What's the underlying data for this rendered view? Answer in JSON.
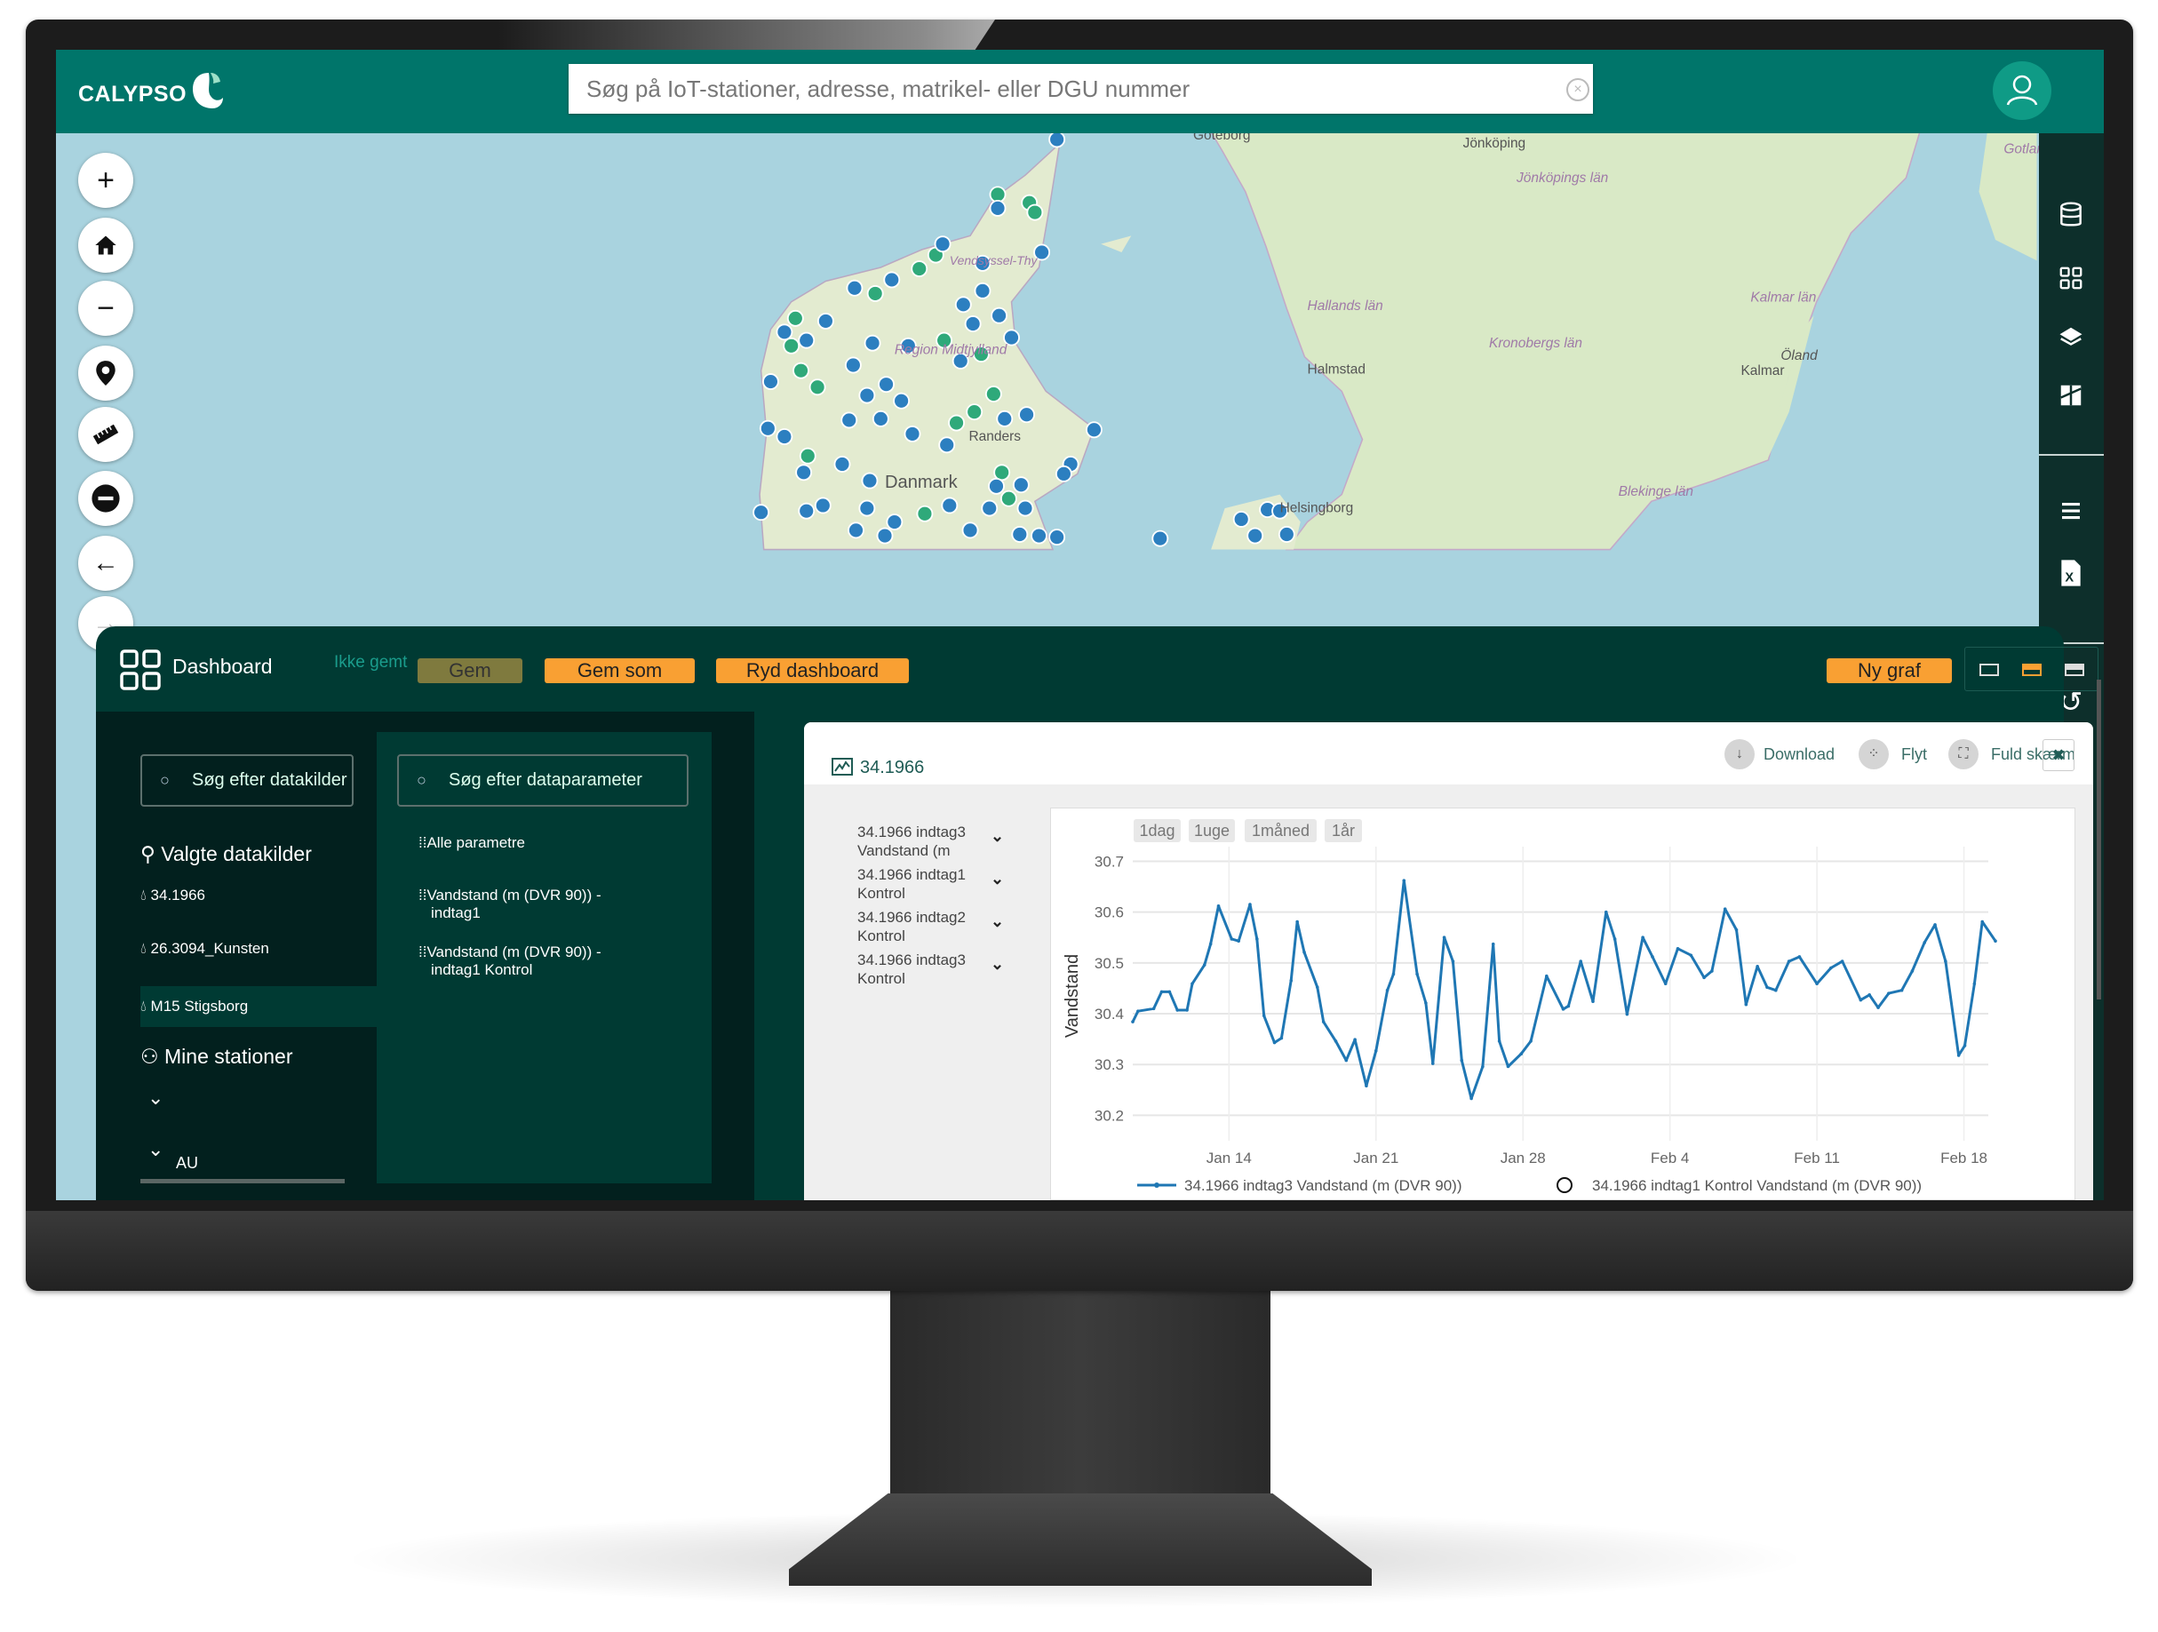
{
  "app": {
    "name": "CALYPSO"
  },
  "search": {
    "placeholder": "Søg på IoT-stationer, adresse, matrikel- eller DGU nummer"
  },
  "map": {
    "labels": [
      "Göteborg",
      "Jönköping",
      "Jönköpings län",
      "Hallands län",
      "Halmstad",
      "Kronobergs län",
      "Kalmar län",
      "Kalmar",
      "Öland",
      "Blekinge län",
      "Helsingborg",
      "Randers",
      "Danmark",
      "Region Midtjylland",
      "Vendsyssel-Thy",
      "Gotland"
    ],
    "colors": {
      "sea": "#a9d3df",
      "land": "#d7e8c4",
      "station_blue": "#2c7fc0",
      "station_green": "#2fa97a"
    },
    "controls": [
      "zoom-in",
      "home",
      "zoom-out",
      "location-pin",
      "measure-ruler",
      "remove",
      "back",
      "forward"
    ]
  },
  "right_toolbar": [
    "database",
    "grid",
    "layers",
    "map-split",
    "list-filter",
    "excel-export",
    "refresh"
  ],
  "dashboard": {
    "title": "Dashboard",
    "status": "Ikke gemt",
    "buttons": {
      "save": "Gem",
      "save_as": "Gem som",
      "clear": "Ryd dashboard",
      "new_chart": "Ny graf"
    },
    "colors": {
      "accent": "#f9a033",
      "disabled": "#7f7a3e",
      "bg": "#003a33"
    },
    "datasources": {
      "search_placeholder": "Søg efter datakilder",
      "selected_heading": "Valgte datakilder",
      "items": [
        "34.1966",
        "26.3094_Kunsten",
        "M15 Stigsborg"
      ],
      "my_stations": "Mine stationer",
      "group": "AU"
    },
    "parameters": {
      "search_placeholder": "Søg efter dataparameter",
      "items": [
        {
          "line1": "Alle parametre",
          "line2": ""
        },
        {
          "line1": "Vandstand (m (DVR 90)) -",
          "line2": "indtag1"
        },
        {
          "line1": "Vandstand (m (DVR 90)) -",
          "line2": "indtag1 Kontrol"
        }
      ]
    },
    "card": {
      "title": "34.1966",
      "actions": {
        "download": "Download",
        "move": "Flyt",
        "fullscreen": "Fuld skærm"
      },
      "series_list": [
        {
          "line1": "34.1966 indtag3",
          "line2": "Vandstand (m"
        },
        {
          "line1": "34.1966 indtag1",
          "line2": "Kontrol"
        },
        {
          "line1": "34.1966 indtag2",
          "line2": "Kontrol"
        },
        {
          "line1": "34.1966 indtag3",
          "line2": "Kontrol"
        }
      ],
      "ranges": [
        "1dag",
        "1uge",
        "1måned",
        "1år"
      ]
    }
  },
  "chart_data": {
    "type": "line",
    "ylabel": "Vandstand",
    "ylim": [
      30.15,
      30.72
    ],
    "xlim": [
      "Jan 9 10:00",
      "Feb 19 12:00"
    ],
    "yticks": [
      "30.2",
      "30.3",
      "30.4",
      "30.5",
      "30.6",
      "30.7"
    ],
    "xticks": [
      "Jan 14",
      "Jan 21",
      "Jan 28",
      "Feb 4",
      "Feb 11",
      "Feb 18"
    ],
    "grid": true,
    "legend_position": "bottom",
    "series": [
      {
        "name": "34.1966 indtag3 Vandstand (m (DVR 90))",
        "color": "#1f77b4",
        "x": [
          "Jan 9 10:00",
          "Jan 9 16:00",
          "Jan 10 10:00",
          "Jan 10 19:00",
          "Jan 11 4:00",
          "Jan 11 13:00",
          "Jan 12 0:00",
          "Jan 12 6:00",
          "Jan 12 20:00",
          "Jan 13 3:00",
          "Jan 13 12:00",
          "Jan 14 3:00",
          "Jan 14 11:00",
          "Jan 15 0:00",
          "Jan 15 8:00",
          "Jan 15 16:00",
          "Jan 16 4:00",
          "Jan 16 12:00",
          "Jan 16 23:00",
          "Jan 17 6:00",
          "Jan 17 14:00",
          "Jan 18 5:00",
          "Jan 18 12:00",
          "Jan 19 2:00",
          "Jan 19 14:00",
          "Jan 20 0:00",
          "Jan 20 13:00",
          "Jan 21 0:00",
          "Jan 21 13:00",
          "Jan 21 20:00",
          "Jan 22 8:00",
          "Jan 22 23:00",
          "Jan 23 9:00",
          "Jan 23 17:00",
          "Jan 24 6:00",
          "Jan 24 16:00",
          "Jan 25 2:00",
          "Jan 25 13:00",
          "Jan 26 2:00",
          "Jan 26 14:00",
          "Jan 26 21:00",
          "Jan 27 7:00",
          "Jan 27 22:00",
          "Jan 28 9:00",
          "Jan 29 3:00",
          "Jan 29 22:00",
          "Jan 30 4:00",
          "Jan 30 18:00",
          "Jan 31 8:00",
          "Jan 31 23:00",
          "Feb 1 9:00",
          "Feb 1 23:00",
          "Feb 2 17:00",
          "Feb 3 4:00",
          "Feb 3 19:00",
          "Feb 4 9:00",
          "Feb 5 0:00",
          "Feb 5 15:00",
          "Feb 6 0:00",
          "Feb 6 15:00",
          "Feb 7 4:00",
          "Feb 7 15:00",
          "Feb 8 4:00",
          "Feb 8 15:00",
          "Feb 9 1:00",
          "Feb 9 16:00",
          "Feb 10 4:00",
          "Feb 11 0:00",
          "Feb 11 16:00",
          "Feb 12 5:00",
          "Feb 13 2:00",
          "Feb 13 12:00",
          "Feb 13 22:00",
          "Feb 14 10:00",
          "Feb 15 1:00",
          "Feb 15 13:00",
          "Feb 16 3:00",
          "Feb 16 15:00",
          "Feb 17 3:00",
          "Feb 17 18:00",
          "Feb 18 1:00",
          "Feb 18 12:00",
          "Feb 18 21:00",
          "Feb 19 12:00"
        ],
        "y": [
          30.384,
          30.405,
          30.41,
          30.443,
          30.443,
          30.407,
          30.407,
          30.459,
          30.496,
          30.537,
          30.612,
          30.547,
          30.543,
          30.615,
          30.547,
          30.396,
          30.343,
          30.352,
          30.465,
          30.581,
          30.521,
          30.452,
          30.384,
          30.346,
          30.308,
          30.349,
          30.258,
          30.327,
          30.446,
          30.478,
          30.662,
          30.478,
          30.421,
          30.302,
          30.55,
          30.503,
          30.308,
          30.233,
          30.296,
          30.537,
          30.346,
          30.296,
          30.321,
          30.346,
          30.474,
          30.409,
          30.415,
          30.503,
          30.424,
          30.6,
          30.547,
          30.399,
          30.55,
          30.512,
          30.459,
          30.528,
          30.515,
          30.471,
          30.484,
          30.606,
          30.565,
          30.418,
          30.493,
          30.452,
          30.446,
          30.503,
          30.512,
          30.459,
          30.49,
          30.503,
          30.427,
          30.437,
          30.412,
          30.44,
          30.446,
          30.484,
          30.54,
          30.575,
          30.503,
          30.318,
          30.337,
          30.459,
          30.581,
          30.543
        ]
      },
      {
        "name": "34.1966 indtag1 Kontrol Vandstand (m (DVR 90))",
        "color": "#1f1f1f",
        "x": [],
        "y": []
      }
    ]
  }
}
